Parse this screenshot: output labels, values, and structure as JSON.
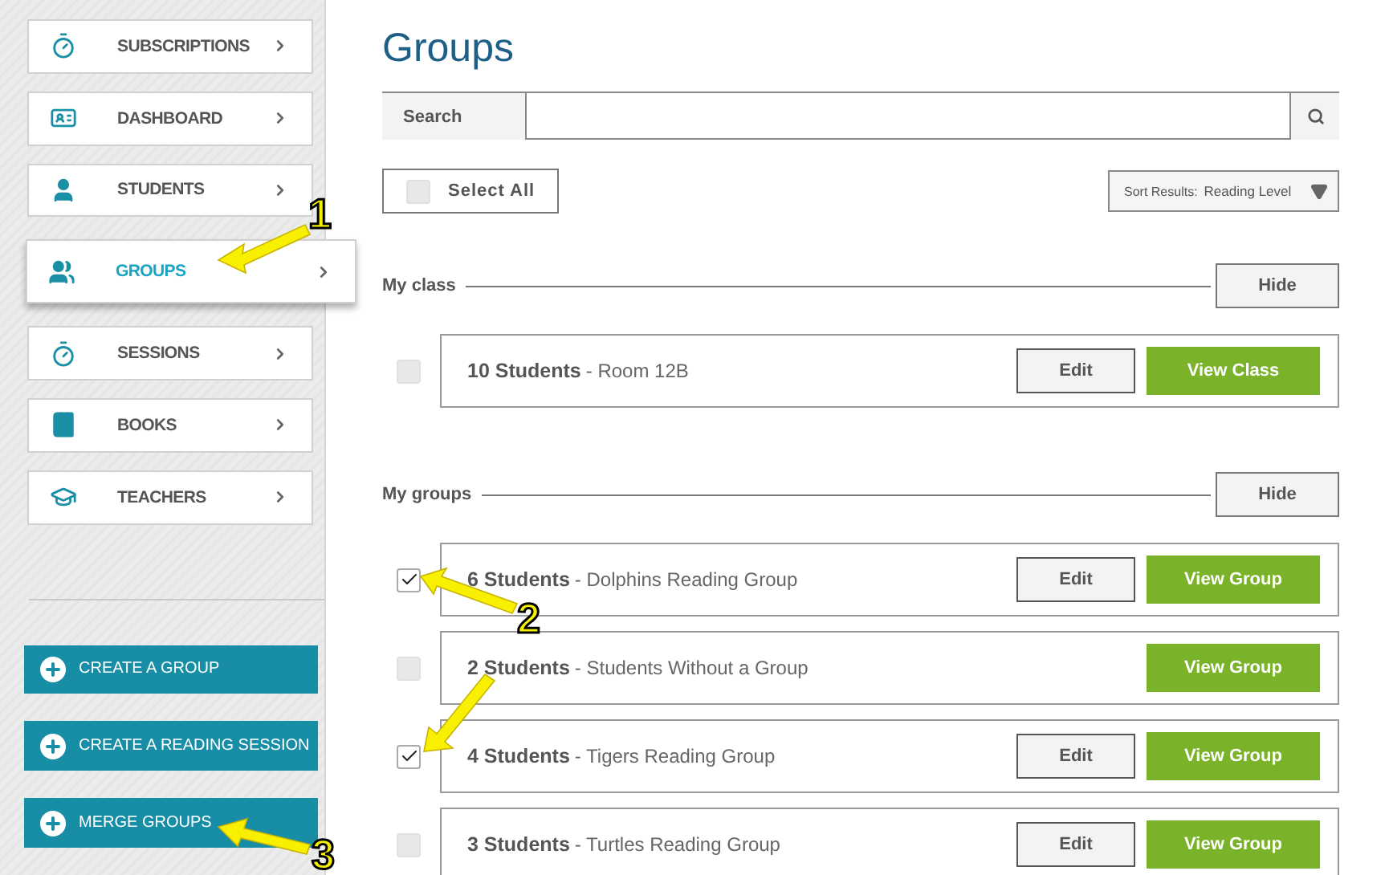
{
  "sidebar": {
    "items": [
      {
        "label": "SUBSCRIPTIONS",
        "selected": false
      },
      {
        "label": "DASHBOARD",
        "selected": false
      },
      {
        "label": "STUDENTS",
        "selected": false
      },
      {
        "label": "GROUPS",
        "selected": true
      },
      {
        "label": "SESSIONS",
        "selected": false
      },
      {
        "label": "BOOKS",
        "selected": false
      },
      {
        "label": "TEACHERS",
        "selected": false
      }
    ],
    "actions": [
      "CREATE A GROUP",
      "CREATE A READING SESSION",
      "MERGE GROUPS"
    ]
  },
  "title": "Groups",
  "search": {
    "label": "Search"
  },
  "select_all": {
    "label": "Select All",
    "checked": false
  },
  "sort": {
    "label": "Sort Results:",
    "value": "Reading Level"
  },
  "sections": [
    {
      "title": "My class",
      "hide": "Hide",
      "rows": [
        {
          "count": "10 Students",
          "name": "- Room 12B",
          "checked": false,
          "edit": "Edit",
          "view": "View Class"
        }
      ]
    },
    {
      "title": "My groups",
      "hide": "Hide",
      "rows": [
        {
          "count": "6 Students",
          "name": "- Dolphins Reading Group",
          "checked": true,
          "edit": "Edit",
          "view": "View Group"
        },
        {
          "count": "2 Students",
          "name": "- Students Without a Group",
          "checked": false,
          "view": "View Group"
        },
        {
          "count": "4 Students",
          "name": "- Tigers Reading Group",
          "checked": true,
          "edit": "Edit",
          "view": "View Group"
        },
        {
          "count": "3 Students",
          "name": "- Turtles Reading Group",
          "checked": false,
          "edit": "Edit",
          "view": "View Group"
        }
      ]
    }
  ],
  "annotations": [
    {
      "label": "1"
    },
    {
      "label": "2"
    },
    {
      "label": "3"
    }
  ]
}
